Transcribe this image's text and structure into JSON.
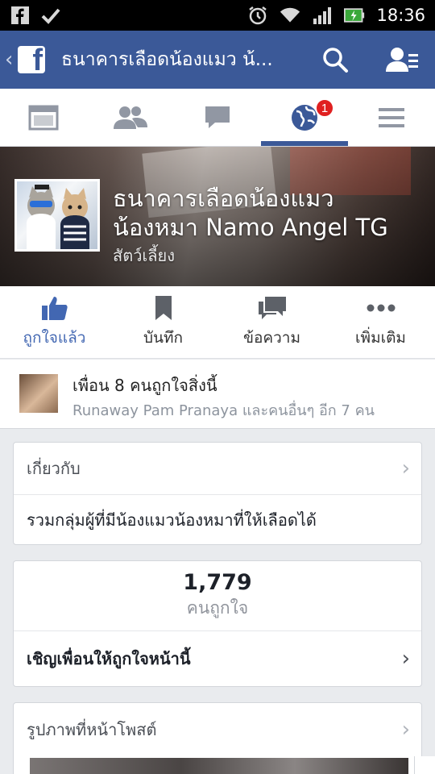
{
  "status_bar": {
    "time": "18:36",
    "left_icons": [
      "facebook-notification-icon",
      "check-icon"
    ],
    "right_icons": [
      "alarm-icon",
      "wifi-icon",
      "signal-icon",
      "battery-charging-icon"
    ]
  },
  "header": {
    "title": "ธนาคารเลือดน้องแมว น้...",
    "icons": [
      "back-chevron-icon",
      "facebook-logo-icon",
      "search-icon",
      "friend-requests-icon"
    ],
    "brand_color": "#3b5998"
  },
  "tabs": [
    {
      "name": "news-feed",
      "icon": "news-feed-icon",
      "active": false
    },
    {
      "name": "friends",
      "icon": "friends-icon",
      "active": false
    },
    {
      "name": "messages",
      "icon": "messages-icon",
      "active": false
    },
    {
      "name": "notifications",
      "icon": "globe-icon",
      "active": true,
      "badge": "1"
    },
    {
      "name": "more",
      "icon": "menu-icon",
      "active": false
    }
  ],
  "page": {
    "name_line1": "ธนาคารเลือดน้องแมว",
    "name_line2": "น้องหมา Namo Angel TG",
    "category": "สัตว์เลี้ยง"
  },
  "actions": [
    {
      "label": "ถูกใจแล้ว",
      "icon": "thumbs-up-icon",
      "active": true
    },
    {
      "label": "บันทึก",
      "icon": "bookmark-icon",
      "active": false
    },
    {
      "label": "ข้อความ",
      "icon": "message-icon",
      "active": false
    },
    {
      "label": "เพิ่มเติม",
      "icon": "more-dots-icon",
      "active": false
    }
  ],
  "friends": {
    "line1": "เพื่อน 8 คนถูกใจสิ่งนี้",
    "line2": "Runaway Pam Pranaya และคนอื่นๆ อีก 7 คน"
  },
  "about": {
    "heading": "เกี่ยวกับ",
    "description": "รวมกลุ่มผู้ที่มีน้องแมวน้องหมาที่ให้เลือดได้"
  },
  "likes": {
    "count": "1,779",
    "label": "คนถูกใจ",
    "invite": "เชิญเพื่อนให้ถูกใจหน้านี้"
  },
  "photos": {
    "heading": "รูปภาพที่หน้าโพสต์"
  },
  "colors": {
    "accent": "#4267b2",
    "badge": "#e02020",
    "muted_text": "#90949c"
  }
}
